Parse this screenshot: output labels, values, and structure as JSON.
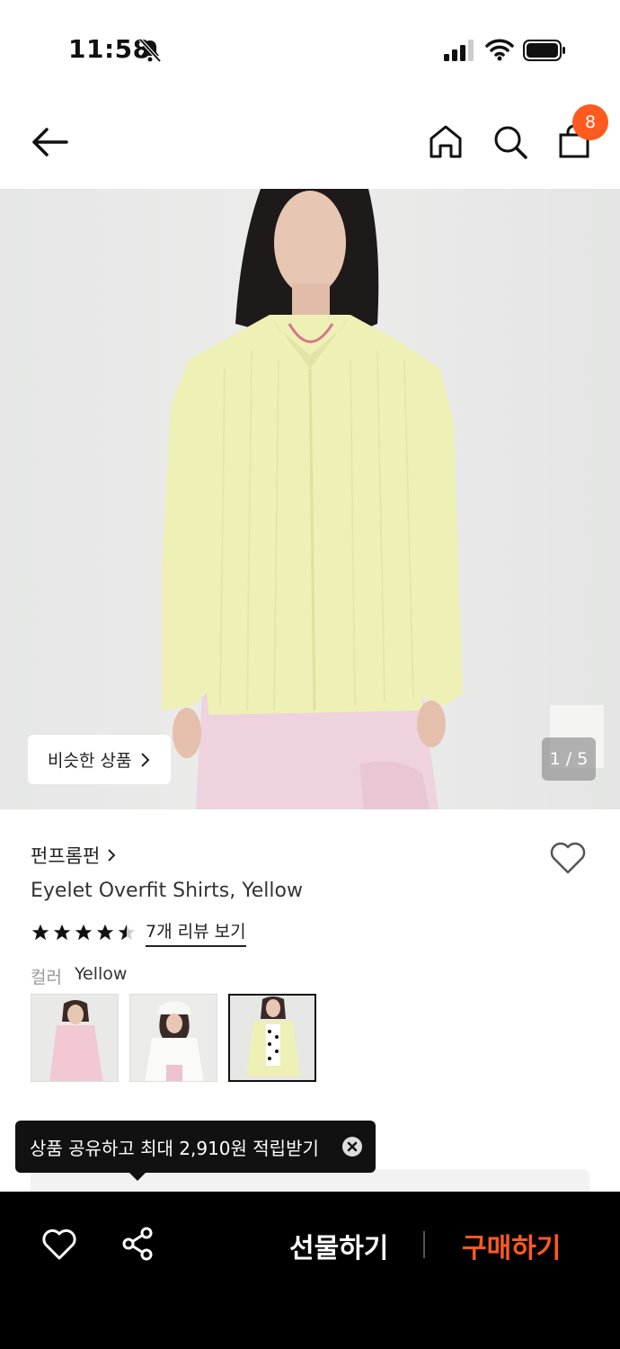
{
  "status": {
    "time": "11:58"
  },
  "nav": {
    "cart_count": "8"
  },
  "hero": {
    "similar_label": "비슷한 상품",
    "page_indicator": "1 / 5"
  },
  "product": {
    "brand": "펀프롬펀",
    "name": "Eyelet Overfit Shirts, Yellow",
    "rating": 4.5,
    "review_link": "7개 리뷰 보기",
    "color_label": "컬러",
    "color_value": "Yellow",
    "swatches": [
      "pink",
      "white",
      "yellow"
    ],
    "selected_swatch": "yellow"
  },
  "tooltip": {
    "text": "상품 공유하고 최대 2,910원 적립받기"
  },
  "bottom_bar": {
    "gift_label": "선물하기",
    "buy_label": "구매하기"
  },
  "colors": {
    "accent": "#ff5a1f",
    "bottom_bar_bg": "#000000",
    "shirt": "#eef0b6"
  }
}
